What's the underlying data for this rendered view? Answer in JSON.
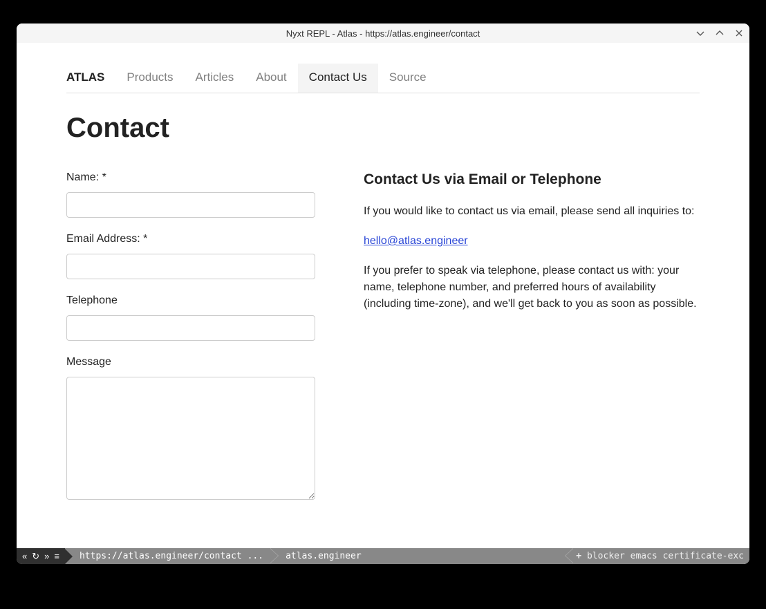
{
  "window": {
    "title": "Nyxt REPL - Atlas - https://atlas.engineer/contact"
  },
  "nav": {
    "brand": "ATLAS",
    "items": [
      "Products",
      "Articles",
      "About",
      "Contact Us",
      "Source"
    ],
    "active_index": 3
  },
  "page": {
    "heading": "Contact"
  },
  "form": {
    "name_label": "Name: *",
    "email_label": "Email Address: *",
    "telephone_label": "Telephone",
    "message_label": "Message",
    "name_value": "",
    "email_value": "",
    "telephone_value": "",
    "message_value": ""
  },
  "sidebar": {
    "heading": "Contact Us via Email or Telephone",
    "intro": "If you would like to contact us via email, please send all inquiries to:",
    "email_link": "hello@atlas.engineer",
    "telephone_text": "If you prefer to speak via telephone, please contact us with: your name, telephone number, and preferred hours of availability (including time-zone), and we'll get back to you as soon as possible."
  },
  "statusbar": {
    "nav_back": "«",
    "nav_reload": "↻",
    "nav_forward": "»",
    "nav_menu": "≡",
    "url": "https://atlas.engineer/contact ...",
    "domain": "atlas.engineer",
    "plus": "+",
    "modes": "blocker  emacs  certificate-exc"
  }
}
